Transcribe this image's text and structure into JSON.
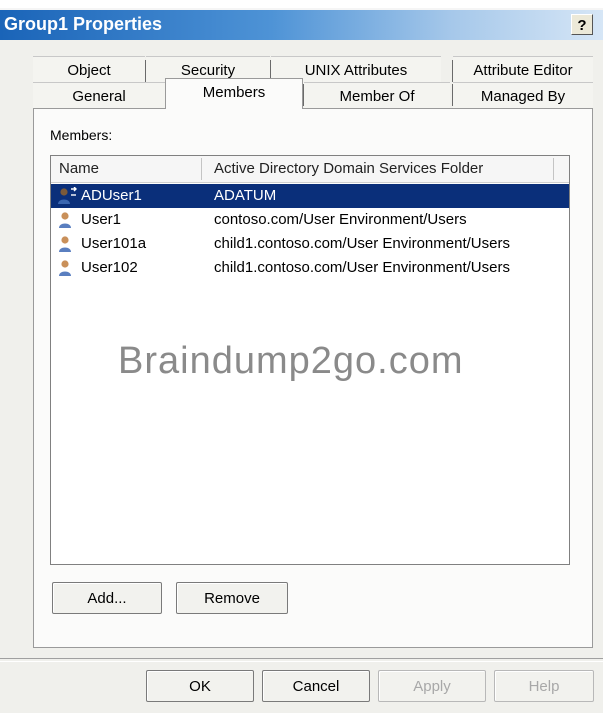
{
  "edge_char": ")",
  "window": {
    "title": "Group1 Properties",
    "help_label": "?"
  },
  "tabs": {
    "row1": [
      "Object",
      "Security",
      "UNIX Attributes",
      "Attribute Editor"
    ],
    "row2": [
      "General",
      "Members",
      "Member Of",
      "Managed By"
    ],
    "active": "Members"
  },
  "members": {
    "label": "Members:",
    "columns": [
      "Name",
      "Active Directory Domain Services Folder"
    ],
    "rows": [
      {
        "name": "ADUser1",
        "folder": "ADATUM",
        "selected": true,
        "icon": "user-transfer-icon"
      },
      {
        "name": "User1",
        "folder": "contoso.com/User Environment/Users",
        "selected": false,
        "icon": "user-icon"
      },
      {
        "name": "User101a",
        "folder": "child1.contoso.com/User Environment/Users",
        "selected": false,
        "icon": "user-icon"
      },
      {
        "name": "User102",
        "folder": "child1.contoso.com/User Environment/Users",
        "selected": false,
        "icon": "user-icon"
      }
    ],
    "watermark": "Braindump2go.com"
  },
  "buttons": {
    "add": "Add...",
    "remove": "Remove",
    "ok": "OK",
    "cancel": "Cancel",
    "apply": "Apply",
    "help": "Help"
  },
  "colors": {
    "selection": "#0a2f7a",
    "title_bar": "#1a64b8"
  }
}
